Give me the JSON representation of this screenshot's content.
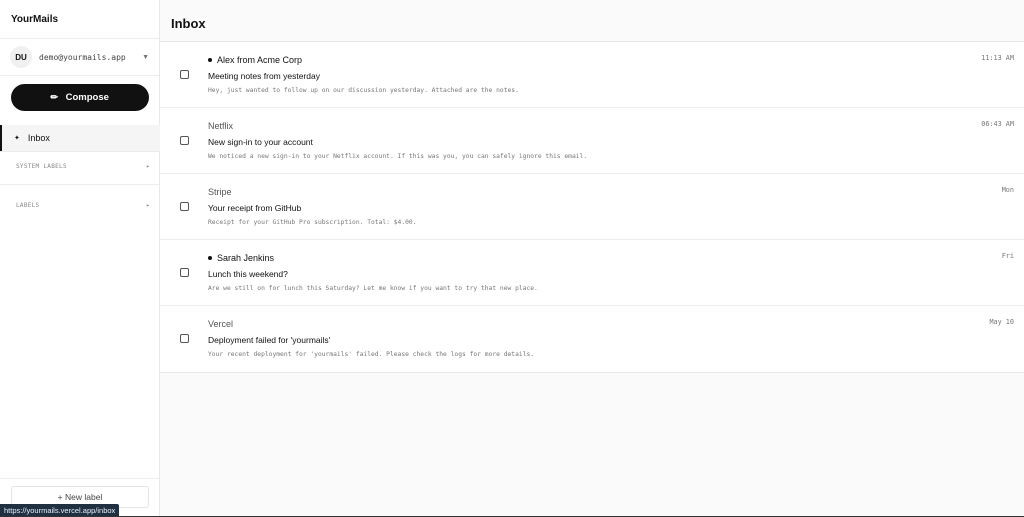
{
  "app": {
    "name": "YourMails"
  },
  "account": {
    "initials": "DU",
    "email": "demo@yourmails.app"
  },
  "sidebar": {
    "compose_label": "Compose",
    "inbox_label": "Inbox",
    "system_labels": "SYSTEM LABELS",
    "labels": "LABELS",
    "new_label": "+ New label"
  },
  "main": {
    "title": "Inbox"
  },
  "emails": [
    {
      "sender": "Alex from Acme Corp",
      "unread": true,
      "subject": "Meeting notes from yesterday",
      "preview": "Hey, just wanted to follow up on our discussion yesterday. Attached are the notes.",
      "date": "11:13 AM"
    },
    {
      "sender": "Netflix",
      "unread": false,
      "subject": "New sign-in to your account",
      "preview": "We noticed a new sign-in to your Netflix account. If this was you, you can safely ignore this email.",
      "date": "06:43 AM"
    },
    {
      "sender": "Stripe",
      "unread": false,
      "subject": "Your receipt from GitHub",
      "preview": "Receipt for your GitHub Pro subscription. Total: $4.00.",
      "date": "Mon"
    },
    {
      "sender": "Sarah Jenkins",
      "unread": true,
      "subject": "Lunch this weekend?",
      "preview": "Are we still on for lunch this Saturday? Let me know if you want to try that new place.",
      "date": "Fri"
    },
    {
      "sender": "Vercel",
      "unread": false,
      "subject": "Deployment failed for 'yourmails'",
      "preview": "Your recent deployment for 'yourmails' failed. Please check the logs for more details.",
      "date": "May 10"
    }
  ],
  "status_bar": {
    "url": "https://yourmails.vercel.app/inbox"
  }
}
